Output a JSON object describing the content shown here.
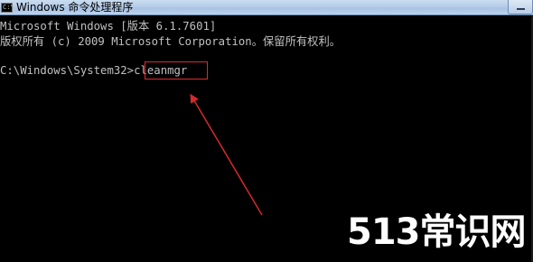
{
  "window": {
    "title": "Windows 命令处理程序",
    "icon": "cmd-icon",
    "icon_text": "C:\\"
  },
  "console": {
    "lines": [
      "Microsoft Windows [版本 6.1.7601]",
      "版权所有 (c) 2009 Microsoft Corporation。保留所有权利。",
      "C:\\Windows\\System32>cleanmgr"
    ],
    "prompt": "C:\\Windows\\System32>",
    "command": "cleanmgr"
  },
  "annotation": {
    "highlight_color": "#e0282a",
    "arrow_color": "#d42a2a"
  },
  "watermark": {
    "text": "513常识网"
  }
}
